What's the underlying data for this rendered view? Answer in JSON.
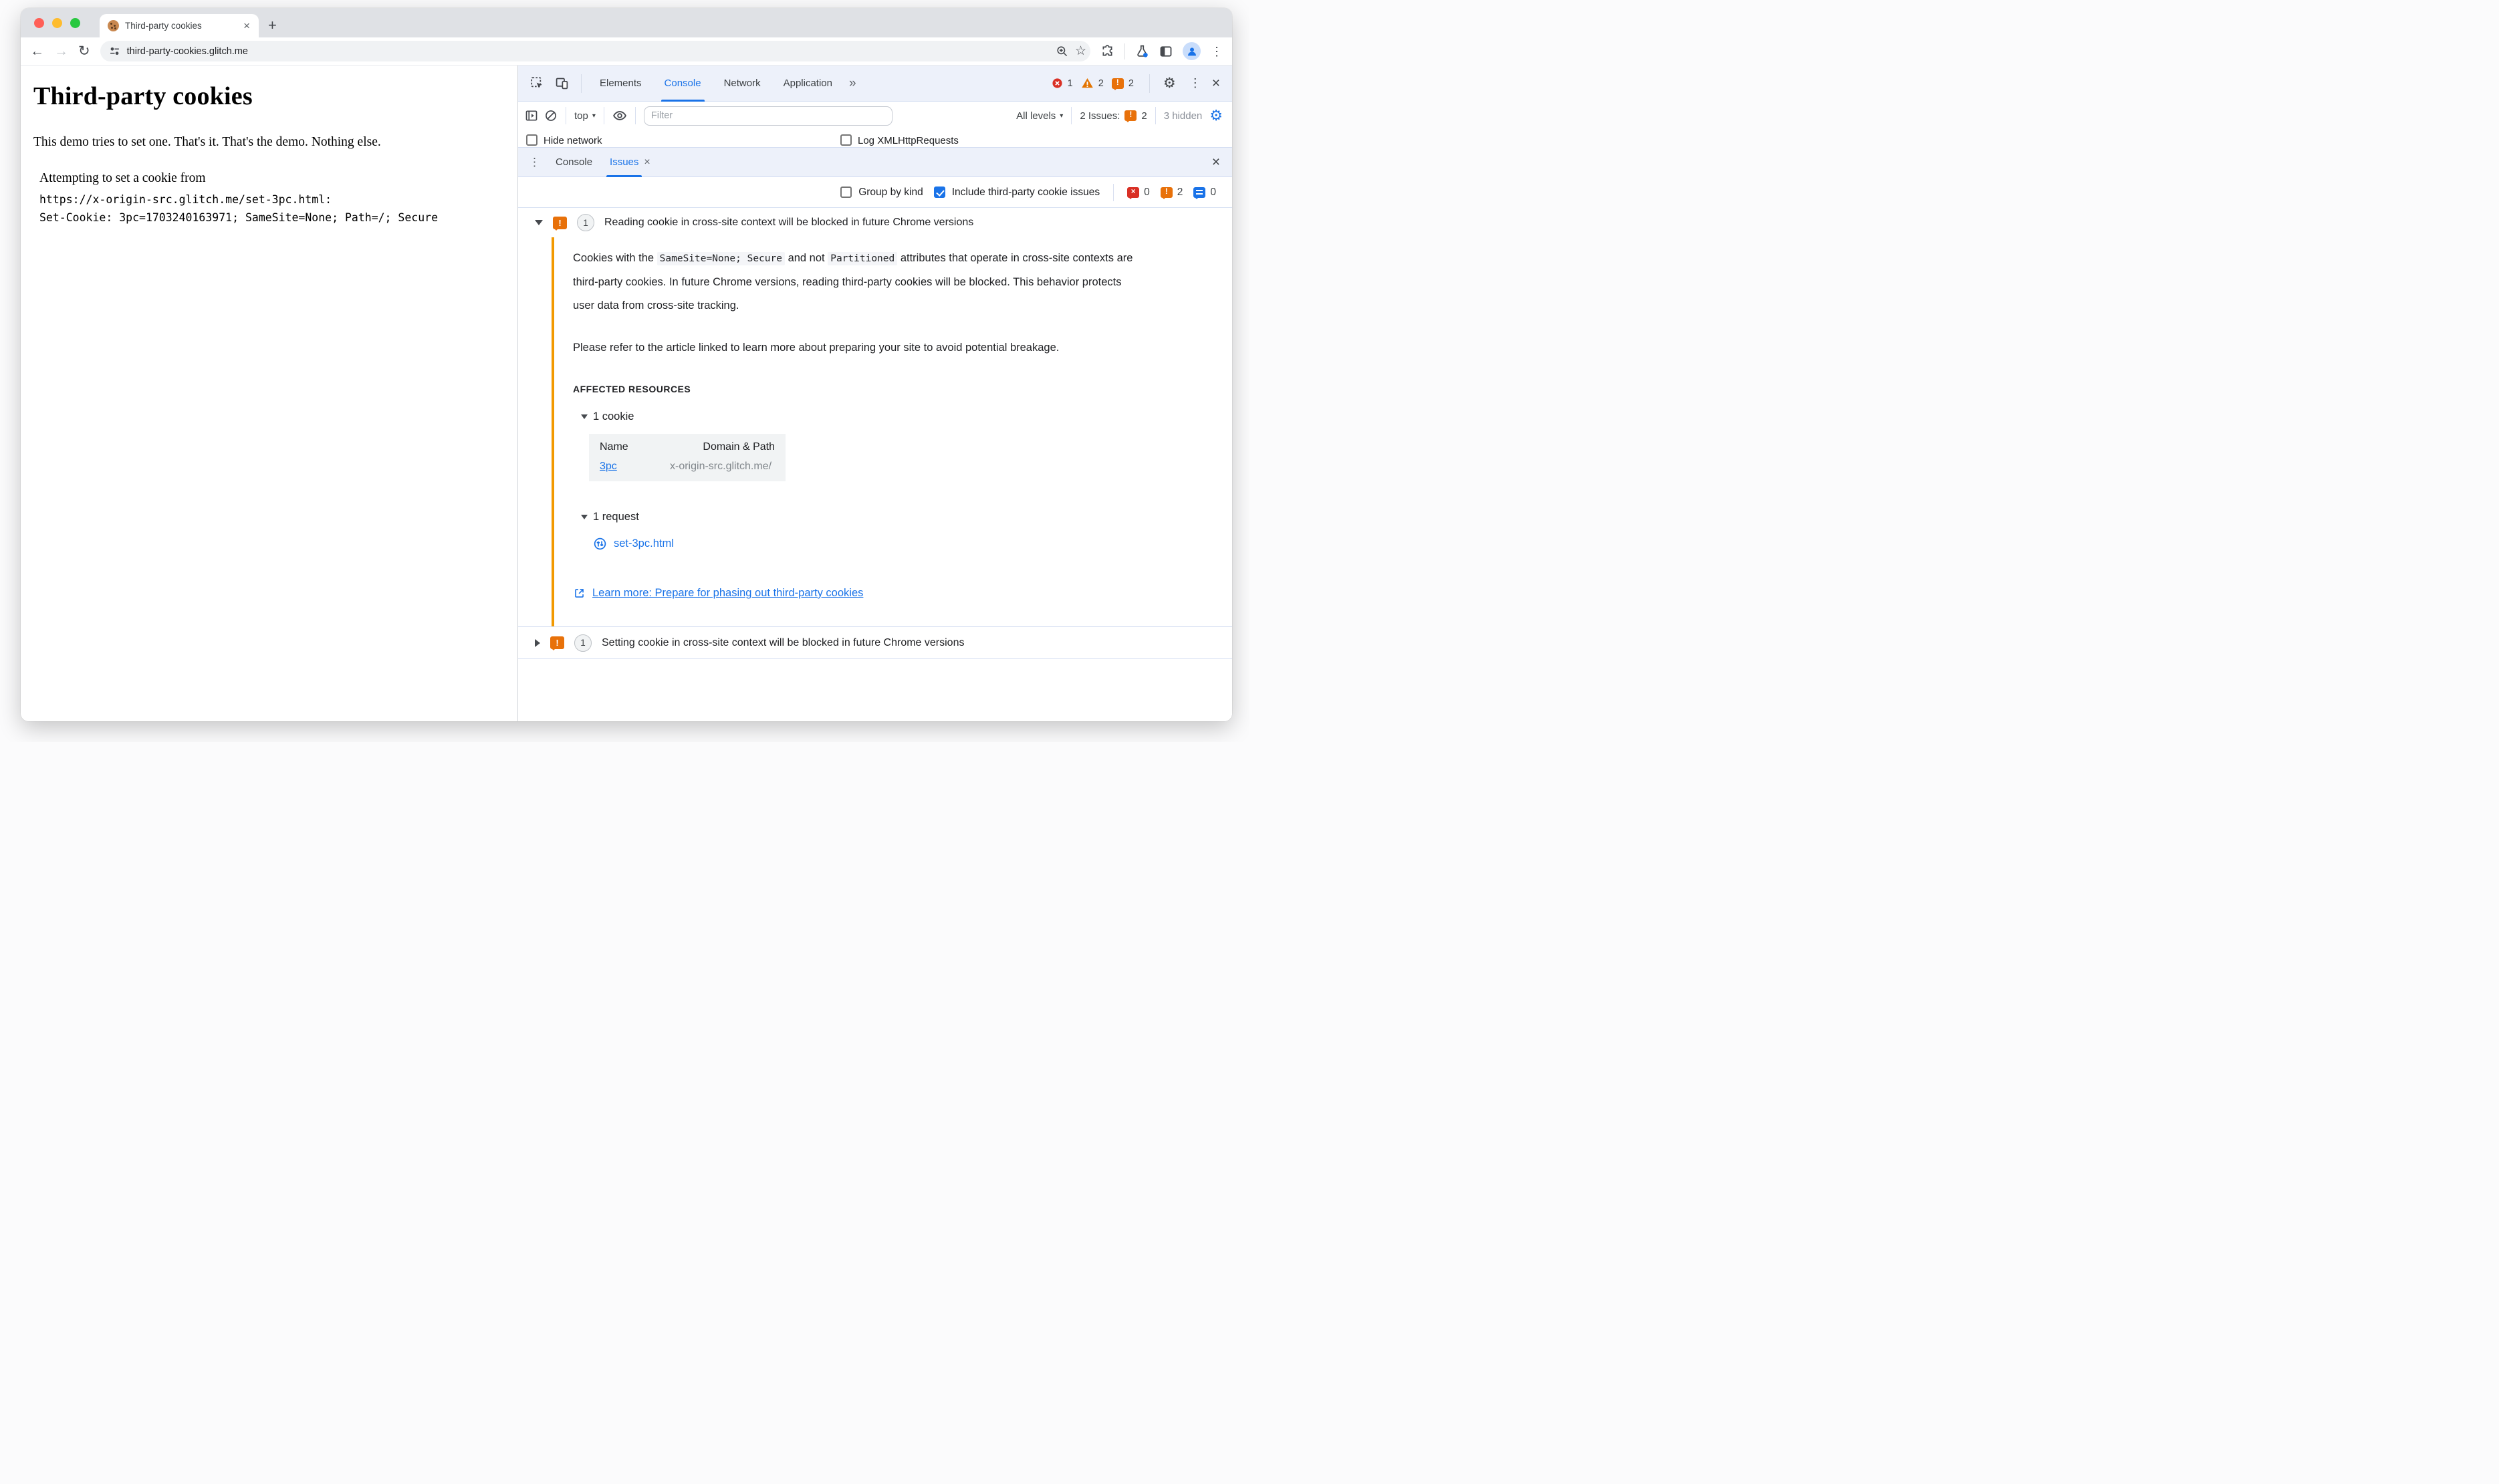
{
  "icons": {
    "close": "×",
    "kebab": "⋮",
    "chevron_more": "»",
    "star": "☆",
    "back": "←",
    "forward": "→",
    "reload": "↻",
    "gear": "⚙",
    "dropdown": "▾",
    "plus": "+",
    "bang": "!",
    "cross": "×"
  },
  "browser": {
    "tab_title": "Third-party cookies",
    "url": "third-party-cookies.glitch.me"
  },
  "page": {
    "heading": "Third-party cookies",
    "intro": "This demo tries to set one. That's it. That's the demo. Nothing else.",
    "attempt_line": "Attempting to set a cookie from",
    "url_line": "https://x-origin-src.glitch.me/set-3pc.html:",
    "cookie_line": "Set-Cookie: 3pc=1703240163971; SameSite=None; Path=/; Secure"
  },
  "devtools": {
    "tabs": [
      {
        "label": "Elements"
      },
      {
        "label": "Console"
      },
      {
        "label": "Network"
      },
      {
        "label": "Application"
      }
    ],
    "badges": {
      "errors": "1",
      "warnings": "2",
      "issues": "2"
    },
    "console_toolbar": {
      "context": "top",
      "filter_placeholder": "Filter",
      "levels": "All levels",
      "issues_label": "2 Issues:",
      "issues_count": "2",
      "hidden_label": "3 hidden"
    },
    "console_settings": {
      "hide_network": "Hide network",
      "log_xhr": "Log XMLHttpRequests"
    },
    "drawer": {
      "tabs": [
        {
          "label": "Console"
        },
        {
          "label": "Issues"
        }
      ]
    },
    "issues_toolbar": {
      "group_by_kind": "Group by kind",
      "include_third_party": "Include third-party cookie issues",
      "counts": {
        "errors": "0",
        "breaking": "2",
        "info": "0"
      }
    },
    "issue1": {
      "count": "1",
      "title": "Reading cookie in cross-site context will be blocked in future Chrome versions",
      "p1_t1": "Cookies with the ",
      "p1_c1": "SameSite=None; Secure",
      "p1_t2": " and not ",
      "p1_c2": "Partitioned",
      "p1_t3": " attributes that operate in cross-site contexts are third-party cookies. In future Chrome versions, reading third-party cookies will be blocked. This behavior protects user data from cross-site tracking.",
      "p2": "Please refer to the article linked to learn more about preparing your site to avoid potential breakage.",
      "affected_label": "Affected resources",
      "cookie_group": "1 cookie",
      "table": {
        "name_header": "Name",
        "domain_header": "Domain & Path",
        "cookie_name": "3pc",
        "cookie_domain": "x-origin-src.glitch.me/"
      },
      "request_group": "1 request",
      "request_file": "set-3pc.html",
      "learn_more": "Learn more: Prepare for phasing out third-party cookies"
    },
    "issue2": {
      "count": "1",
      "title": "Setting cookie in cross-site context will be blocked in future Chrome versions"
    }
  }
}
